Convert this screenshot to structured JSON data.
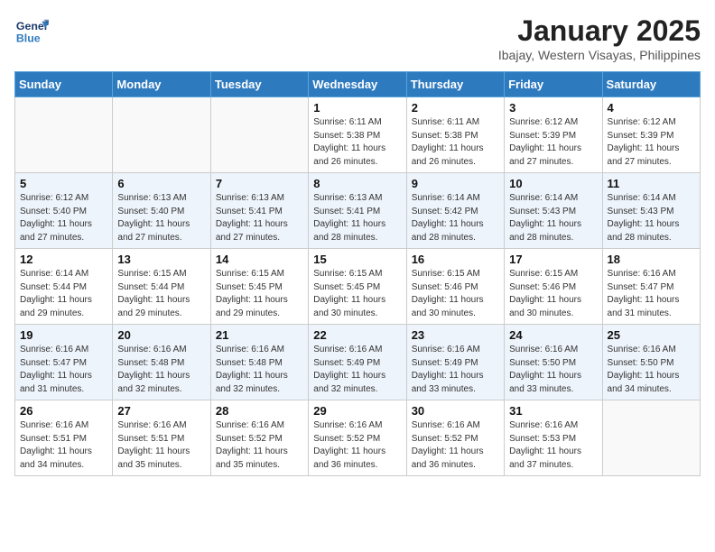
{
  "header": {
    "logo_general": "General",
    "logo_blue": "Blue",
    "month": "January 2025",
    "location": "Ibajay, Western Visayas, Philippines"
  },
  "weekdays": [
    "Sunday",
    "Monday",
    "Tuesday",
    "Wednesday",
    "Thursday",
    "Friday",
    "Saturday"
  ],
  "weeks": [
    [
      {
        "day": "",
        "info": ""
      },
      {
        "day": "",
        "info": ""
      },
      {
        "day": "",
        "info": ""
      },
      {
        "day": "1",
        "info": "Sunrise: 6:11 AM\nSunset: 5:38 PM\nDaylight: 11 hours\nand 26 minutes."
      },
      {
        "day": "2",
        "info": "Sunrise: 6:11 AM\nSunset: 5:38 PM\nDaylight: 11 hours\nand 26 minutes."
      },
      {
        "day": "3",
        "info": "Sunrise: 6:12 AM\nSunset: 5:39 PM\nDaylight: 11 hours\nand 27 minutes."
      },
      {
        "day": "4",
        "info": "Sunrise: 6:12 AM\nSunset: 5:39 PM\nDaylight: 11 hours\nand 27 minutes."
      }
    ],
    [
      {
        "day": "5",
        "info": "Sunrise: 6:12 AM\nSunset: 5:40 PM\nDaylight: 11 hours\nand 27 minutes."
      },
      {
        "day": "6",
        "info": "Sunrise: 6:13 AM\nSunset: 5:40 PM\nDaylight: 11 hours\nand 27 minutes."
      },
      {
        "day": "7",
        "info": "Sunrise: 6:13 AM\nSunset: 5:41 PM\nDaylight: 11 hours\nand 27 minutes."
      },
      {
        "day": "8",
        "info": "Sunrise: 6:13 AM\nSunset: 5:41 PM\nDaylight: 11 hours\nand 28 minutes."
      },
      {
        "day": "9",
        "info": "Sunrise: 6:14 AM\nSunset: 5:42 PM\nDaylight: 11 hours\nand 28 minutes."
      },
      {
        "day": "10",
        "info": "Sunrise: 6:14 AM\nSunset: 5:43 PM\nDaylight: 11 hours\nand 28 minutes."
      },
      {
        "day": "11",
        "info": "Sunrise: 6:14 AM\nSunset: 5:43 PM\nDaylight: 11 hours\nand 28 minutes."
      }
    ],
    [
      {
        "day": "12",
        "info": "Sunrise: 6:14 AM\nSunset: 5:44 PM\nDaylight: 11 hours\nand 29 minutes."
      },
      {
        "day": "13",
        "info": "Sunrise: 6:15 AM\nSunset: 5:44 PM\nDaylight: 11 hours\nand 29 minutes."
      },
      {
        "day": "14",
        "info": "Sunrise: 6:15 AM\nSunset: 5:45 PM\nDaylight: 11 hours\nand 29 minutes."
      },
      {
        "day": "15",
        "info": "Sunrise: 6:15 AM\nSunset: 5:45 PM\nDaylight: 11 hours\nand 30 minutes."
      },
      {
        "day": "16",
        "info": "Sunrise: 6:15 AM\nSunset: 5:46 PM\nDaylight: 11 hours\nand 30 minutes."
      },
      {
        "day": "17",
        "info": "Sunrise: 6:15 AM\nSunset: 5:46 PM\nDaylight: 11 hours\nand 30 minutes."
      },
      {
        "day": "18",
        "info": "Sunrise: 6:16 AM\nSunset: 5:47 PM\nDaylight: 11 hours\nand 31 minutes."
      }
    ],
    [
      {
        "day": "19",
        "info": "Sunrise: 6:16 AM\nSunset: 5:47 PM\nDaylight: 11 hours\nand 31 minutes."
      },
      {
        "day": "20",
        "info": "Sunrise: 6:16 AM\nSunset: 5:48 PM\nDaylight: 11 hours\nand 32 minutes."
      },
      {
        "day": "21",
        "info": "Sunrise: 6:16 AM\nSunset: 5:48 PM\nDaylight: 11 hours\nand 32 minutes."
      },
      {
        "day": "22",
        "info": "Sunrise: 6:16 AM\nSunset: 5:49 PM\nDaylight: 11 hours\nand 32 minutes."
      },
      {
        "day": "23",
        "info": "Sunrise: 6:16 AM\nSunset: 5:49 PM\nDaylight: 11 hours\nand 33 minutes."
      },
      {
        "day": "24",
        "info": "Sunrise: 6:16 AM\nSunset: 5:50 PM\nDaylight: 11 hours\nand 33 minutes."
      },
      {
        "day": "25",
        "info": "Sunrise: 6:16 AM\nSunset: 5:50 PM\nDaylight: 11 hours\nand 34 minutes."
      }
    ],
    [
      {
        "day": "26",
        "info": "Sunrise: 6:16 AM\nSunset: 5:51 PM\nDaylight: 11 hours\nand 34 minutes."
      },
      {
        "day": "27",
        "info": "Sunrise: 6:16 AM\nSunset: 5:51 PM\nDaylight: 11 hours\nand 35 minutes."
      },
      {
        "day": "28",
        "info": "Sunrise: 6:16 AM\nSunset: 5:52 PM\nDaylight: 11 hours\nand 35 minutes."
      },
      {
        "day": "29",
        "info": "Sunrise: 6:16 AM\nSunset: 5:52 PM\nDaylight: 11 hours\nand 36 minutes."
      },
      {
        "day": "30",
        "info": "Sunrise: 6:16 AM\nSunset: 5:52 PM\nDaylight: 11 hours\nand 36 minutes."
      },
      {
        "day": "31",
        "info": "Sunrise: 6:16 AM\nSunset: 5:53 PM\nDaylight: 11 hours\nand 37 minutes."
      },
      {
        "day": "",
        "info": ""
      }
    ]
  ]
}
